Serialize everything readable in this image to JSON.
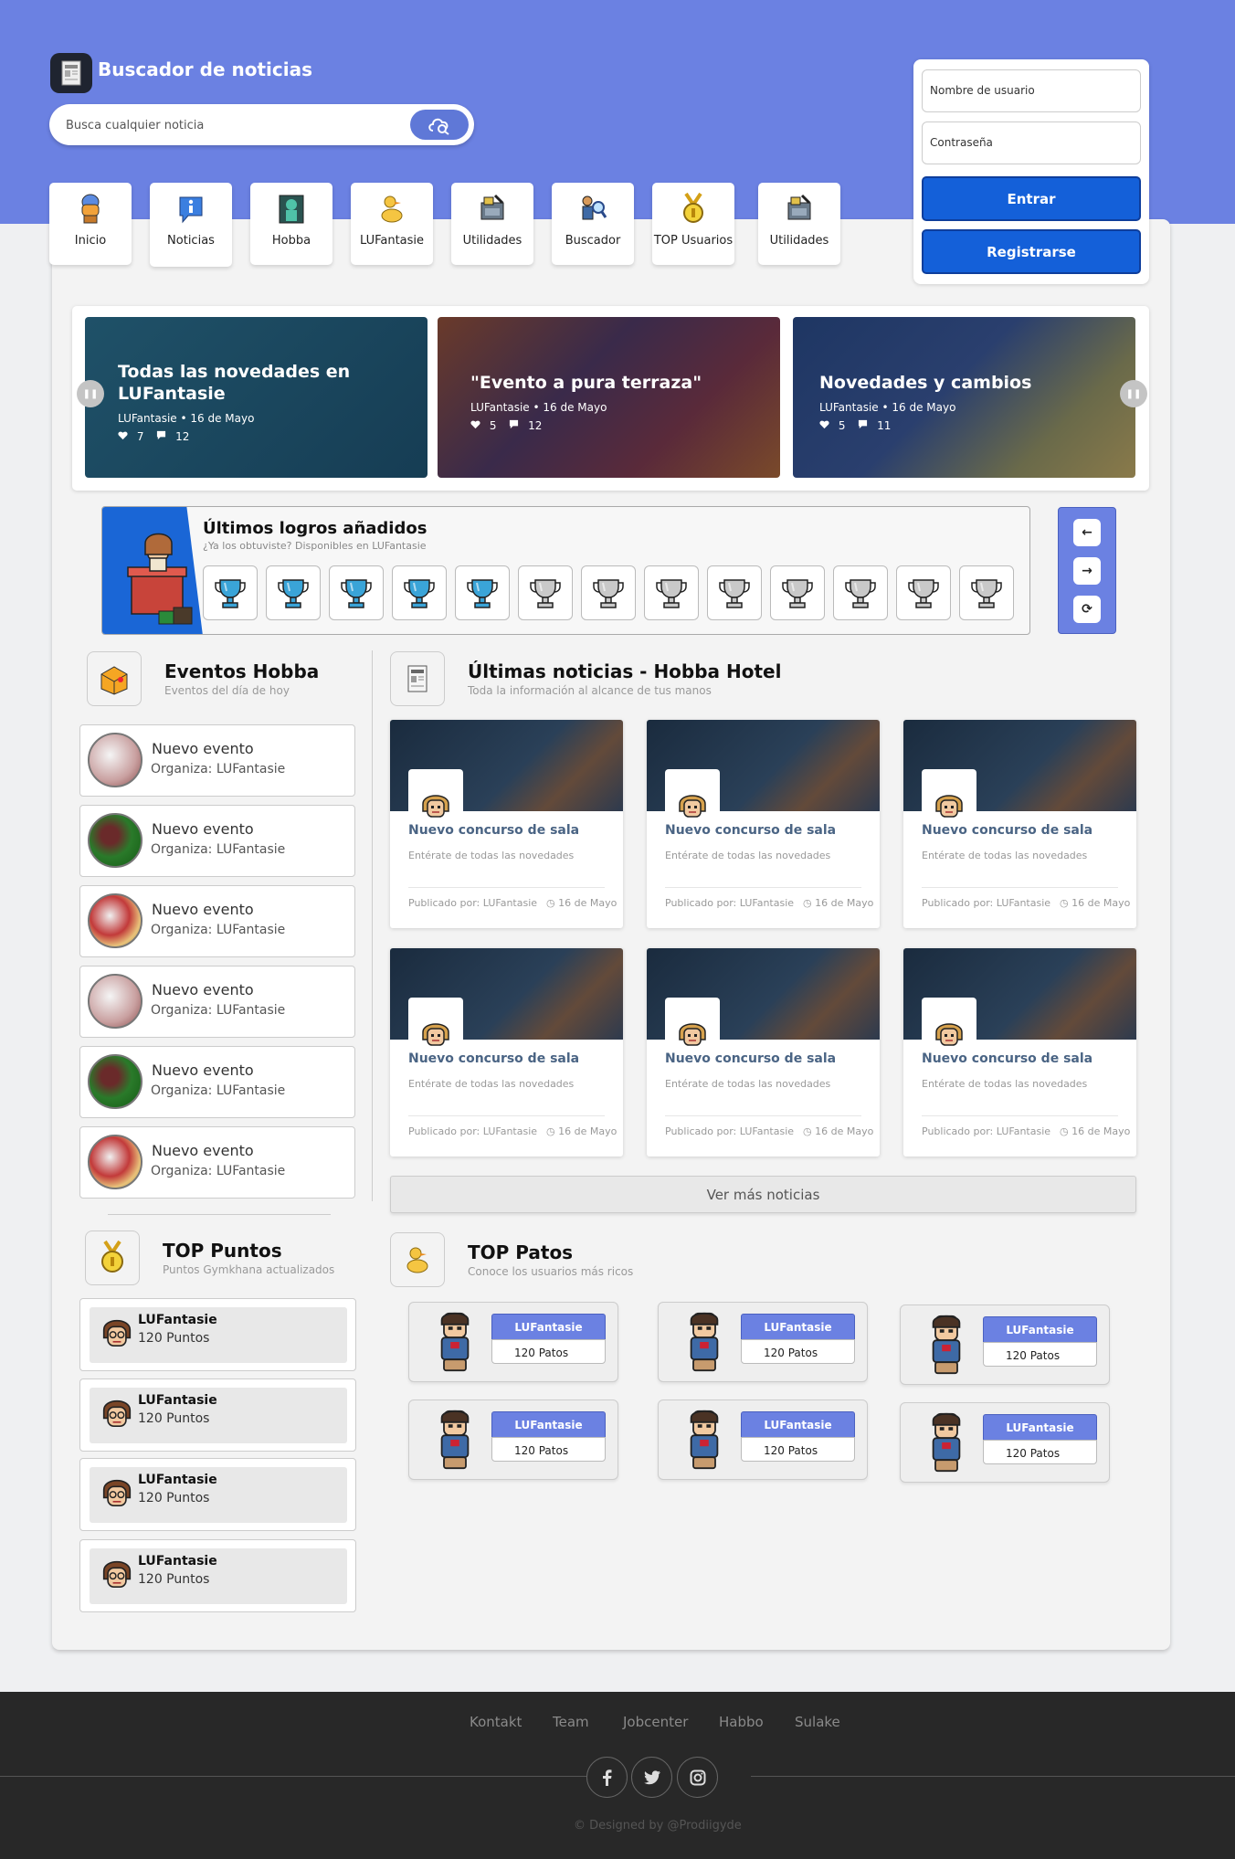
{
  "site": {
    "title": "Buscador de noticias",
    "search_placeholder": "Busca cualquier noticia"
  },
  "login": {
    "username_placeholder": "Nombre de usuario",
    "password_placeholder": "Contraseña",
    "login_label": "Entrar",
    "register_label": "Registrarse"
  },
  "nav": {
    "items": [
      {
        "label": "Inicio",
        "icon": "lamp-icon"
      },
      {
        "label": "Noticias",
        "icon": "info-bubble-icon"
      },
      {
        "label": "Hobba",
        "icon": "statue-icon"
      },
      {
        "label": "LUFantasie",
        "icon": "duck-icon"
      },
      {
        "label": "Utilidades",
        "icon": "tools-icon"
      },
      {
        "label": "Buscador",
        "icon": "magnifier-icon"
      },
      {
        "label": "TOP Usuarios",
        "icon": "medal-icon"
      },
      {
        "label": "Utilidades",
        "icon": "tools-icon"
      }
    ]
  },
  "slider": {
    "slides": [
      {
        "title": "Todas las novedades en LUFantasie",
        "meta": "LUFantasie • 16 de Mayo",
        "likes": "7",
        "comments": "12"
      },
      {
        "title": "\"Evento a pura terraza\"",
        "meta": "LUFantasie • 16 de Mayo",
        "likes": "5",
        "comments": "12"
      },
      {
        "title": "Novedades y cambios",
        "meta": "LUFantasie • 16 de Mayo",
        "likes": "5",
        "comments": "11"
      }
    ]
  },
  "achievements": {
    "title": "Últimos logros añadidos",
    "subtitle": "¿Ya los obtuviste? Disponibles en LUFantasie",
    "badges": [
      "blue",
      "blue",
      "blue",
      "blue",
      "blue",
      "silver",
      "silver",
      "silver",
      "silver",
      "silver",
      "silver",
      "silver",
      "silver"
    ],
    "controls": {
      "prev": "←",
      "next": "→",
      "refresh": "⟳"
    }
  },
  "events": {
    "title": "Eventos Hobba",
    "subtitle": "Eventos del día de hoy",
    "items": [
      {
        "title": "Nuevo evento",
        "org": "Organiza: LUFantasie"
      },
      {
        "title": "Nuevo evento",
        "org": "Organiza: LUFantasie"
      },
      {
        "title": "Nuevo evento",
        "org": "Organiza: LUFantasie"
      },
      {
        "title": "Nuevo evento",
        "org": "Organiza: LUFantasie"
      },
      {
        "title": "Nuevo evento",
        "org": "Organiza: LUFantasie"
      },
      {
        "title": "Nuevo evento",
        "org": "Organiza: LUFantasie"
      }
    ]
  },
  "news": {
    "title": "Últimas noticias - Hobba Hotel",
    "subtitle": "Toda la información al alcance de tus manos",
    "items": [
      {
        "title": "Nuevo concurso de sala",
        "desc": "Entérate de todas las novedades",
        "author": "Publicado por: LUFantasie",
        "date": "16 de Mayo"
      },
      {
        "title": "Nuevo concurso de sala",
        "desc": "Entérate de todas las novedades",
        "author": "Publicado por: LUFantasie",
        "date": "16 de Mayo"
      },
      {
        "title": "Nuevo concurso de sala",
        "desc": "Entérate de todas las novedades",
        "author": "Publicado por: LUFantasie",
        "date": "16 de Mayo"
      },
      {
        "title": "Nuevo concurso de sala",
        "desc": "Entérate de todas las novedades",
        "author": "Publicado por: LUFantasie",
        "date": "16 de Mayo"
      },
      {
        "title": "Nuevo concurso de sala",
        "desc": "Entérate de todas las novedades",
        "author": "Publicado por: LUFantasie",
        "date": "16 de Mayo"
      },
      {
        "title": "Nuevo concurso de sala",
        "desc": "Entérate de todas las novedades",
        "author": "Publicado por: LUFantasie",
        "date": "16 de Mayo"
      }
    ],
    "more_label": "Ver más noticias"
  },
  "top_points": {
    "title": "TOP Puntos",
    "subtitle": "Puntos Gymkhana actualizados",
    "items": [
      {
        "name": "LUFantasie",
        "value": "120 Puntos"
      },
      {
        "name": "LUFantasie",
        "value": "120 Puntos"
      },
      {
        "name": "LUFantasie",
        "value": "120 Puntos"
      },
      {
        "name": "LUFantasie",
        "value": "120 Puntos"
      }
    ]
  },
  "top_ducks": {
    "title": "TOP Patos",
    "subtitle": "Conoce los usuarios más ricos",
    "items": [
      {
        "name": "LUFantasie",
        "value": "120 Patos"
      },
      {
        "name": "LUFantasie",
        "value": "120 Patos"
      },
      {
        "name": "LUFantasie",
        "value": "120 Patos"
      },
      {
        "name": "LUFantasie",
        "value": "120 Patos"
      },
      {
        "name": "LUFantasie",
        "value": "120 Patos"
      },
      {
        "name": "LUFantasie",
        "value": "120 Patos"
      }
    ]
  },
  "footer": {
    "links": [
      "Kontakt",
      "Team",
      "Jobcenter",
      "Habbo",
      "Sulake"
    ],
    "social": [
      "facebook-icon",
      "twitter-icon",
      "instagram-icon"
    ],
    "credit": "© Designed by @Prodiigyde"
  },
  "colors": {
    "brand": "#6b81e2",
    "button": "#1460d9",
    "footer": "#282828"
  }
}
